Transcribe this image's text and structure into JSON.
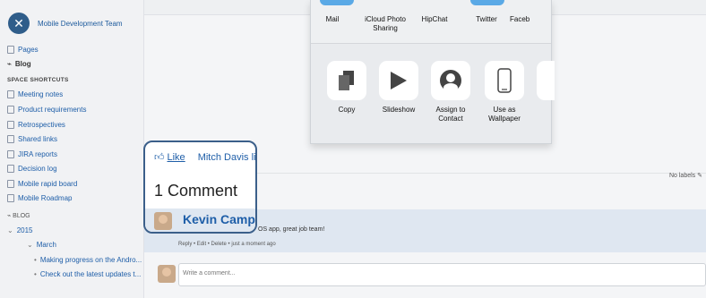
{
  "sidebar": {
    "space_title": "Mobile Development Team",
    "pages": "Pages",
    "blog": "Blog",
    "shortcuts_heading": "SPACE SHORTCUTS",
    "shortcuts": [
      "Meeting notes",
      "Product requirements",
      "Retrospectives",
      "Shared links",
      "JIRA reports",
      "Decision log",
      "Mobile rapid board",
      "Mobile Roadmap"
    ],
    "blog_heading": "BLOG",
    "year": "2015",
    "month": "March",
    "posts": [
      "Making progress on the Andro...",
      "Check out the latest updates t..."
    ]
  },
  "share": {
    "apps": [
      "Mail",
      "iCloud Photo Sharing",
      "HipChat",
      "Twitter",
      "Faceb"
    ],
    "actions": [
      "Copy",
      "Slideshow",
      "Assign to Contact",
      "Use as Wallpaper"
    ]
  },
  "card": {
    "like_label": "Like",
    "liker": "Mitch Davis li",
    "comment_count": "1 Comment",
    "commenter": "Kevin Campb"
  },
  "labels_text": "No labels",
  "comment": {
    "text": "OS app, great job team!",
    "meta": "Reply • Edit • Delete • just a moment ago"
  },
  "reply_placeholder": "Write a comment..."
}
